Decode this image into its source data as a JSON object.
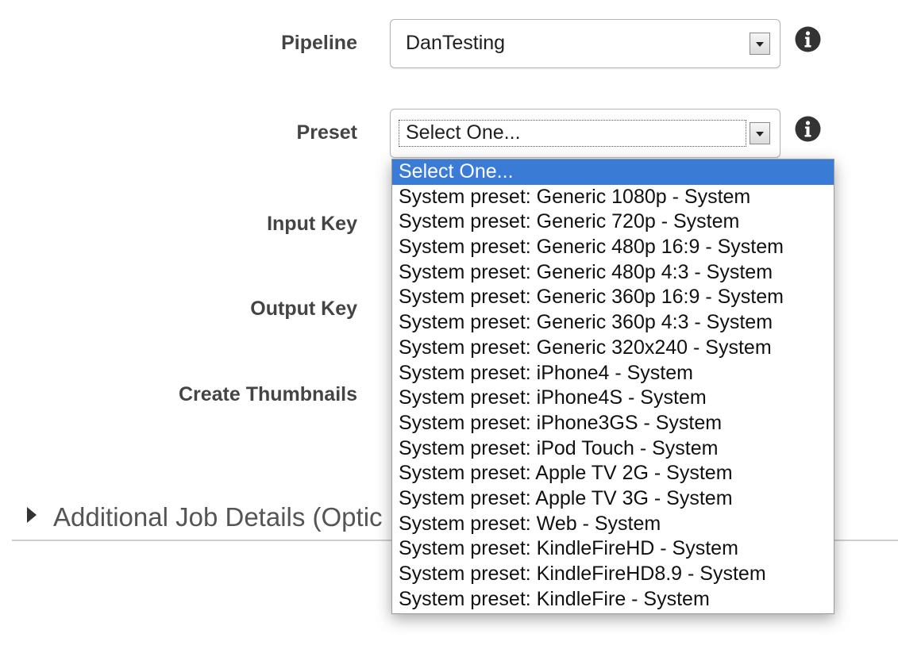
{
  "form": {
    "pipeline": {
      "label": "Pipeline",
      "value": "DanTesting"
    },
    "preset": {
      "label": "Preset",
      "value": "Select One..."
    },
    "input_key": {
      "label": "Input Key"
    },
    "output_key": {
      "label": "Output Key"
    },
    "create_thumbnails": {
      "label": "Create Thumbnails"
    }
  },
  "icons": {
    "info": "info-circle-icon",
    "dropdown_arrow": "chevron-down-icon",
    "expand": "triangle-right-icon"
  },
  "preset_dropdown": {
    "options": [
      "Select One...",
      "System preset: Generic 1080p - System",
      "System preset: Generic 720p - System",
      "System preset: Generic 480p 16:9 - System",
      "System preset: Generic 480p 4:3 - System",
      "System preset: Generic 360p 16:9 - System",
      "System preset: Generic 360p 4:3 - System",
      "System preset: Generic 320x240 - System",
      "System preset: iPhone4 - System",
      "System preset: iPhone4S - System",
      "System preset: iPhone3GS - System",
      "System preset: iPod Touch - System",
      "System preset: Apple TV 2G - System",
      "System preset: Apple TV 3G - System",
      "System preset: Web - System",
      "System preset: KindleFireHD - System",
      "System preset: KindleFireHD8.9 - System",
      "System preset: KindleFire - System"
    ],
    "highlighted_index": 0
  },
  "additional_details": {
    "label": "Additional Job Details (Optic"
  },
  "colors": {
    "highlight": "#3a7bd5",
    "label_text": "#444444"
  }
}
